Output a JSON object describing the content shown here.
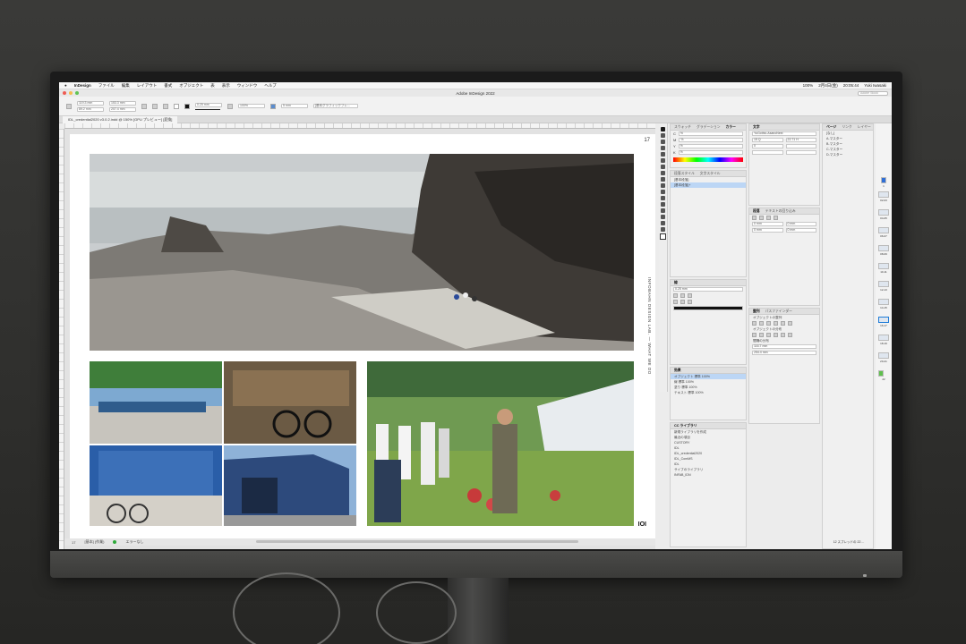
{
  "menubar": {
    "apple": "",
    "app_name": "InDesign",
    "menus": [
      "ファイル",
      "編集",
      "レイアウト",
      "書式",
      "オブジェクト",
      "表",
      "表示",
      "ウィンドウ",
      "ヘルプ"
    ],
    "right": [
      "100%",
      "2月4日(金)",
      "20:05:44",
      "Yuki Iwasaki"
    ]
  },
  "window": {
    "title": "Adobe InDesign 2022",
    "search_placeholder": "Adobe Stock"
  },
  "controlbar": {
    "x": "119.3 mm",
    "y": "89.2 mm",
    "w": "153.3 mm",
    "h": "207.4 mm",
    "stroke": "0.25 mm",
    "opacity": "100%",
    "offset": "5 mm",
    "style": "[基本グラフィックフレ..."
  },
  "doc_tab": "IDL_credential2020 v3.0.2.indd @ 150% [GPU プレビュー] [変換]",
  "page": {
    "number": "17",
    "side_text": "INFOBAHN DESIGN LAB. — WHAT WE DO",
    "logo": "IOI"
  },
  "statusbar": {
    "page": "17",
    "style": "[基本] (作業)",
    "errors": "エラーなし"
  },
  "colors": {
    "accent": "#1e7cd7",
    "selection": "#bcd6f5",
    "error_ok": "#2eaa3a"
  },
  "panels": {
    "swatch_tabs": [
      "スウォッチ",
      "グラデーション",
      "カラー"
    ],
    "swatch_channels": [
      "C",
      "M",
      "Y",
      "K"
    ],
    "swatch_values": [
      "%",
      "%",
      "%",
      "%"
    ],
    "char_style_tabs": [
      "段落スタイル",
      "文字スタイル"
    ],
    "char_style_items": [
      "[基本段落]",
      "[基本段落]+"
    ],
    "character_tabs": [
      "文字"
    ],
    "font": "YuGothic-AsanoNext",
    "font_size": "15 Q",
    "leading": "22.71 H",
    "tracking": "0",
    "paragraph_tabs": [
      "段落",
      "テキストの回り込み"
    ],
    "indent": "0 mm",
    "stroke_tabs": [
      "線"
    ],
    "stroke_width": "0.25 mm",
    "effect_tabs": [
      "効果"
    ],
    "effect_items": [
      {
        "label": "オブジェクト",
        "value": "標準 100%"
      },
      {
        "label": "線",
        "value": "標準 100%"
      },
      {
        "label": "塗り",
        "value": "標準 100%"
      },
      {
        "label": "テキスト",
        "value": "標準 100%"
      }
    ],
    "cc_tabs": [
      "CC ライブラリ"
    ],
    "cc_items": [
      "新規ライブラリを作成",
      "最近の項目",
      "CUSTORY",
      "IDL",
      "IDL_credential2020",
      "IDL_ComMS",
      "IDL",
      "サイブのライブラリ",
      "INFAB_IDN"
    ],
    "align_tabs": [
      "整列",
      "パスファインダー"
    ],
    "align_labels": [
      "オブジェクトの整列",
      "オブジェクトの分布",
      "間隔の分布"
    ],
    "transform_x": "116.7 mm",
    "transform_y": "254.4 mm",
    "pages_tabs": [
      "ページ",
      "リンク",
      "レイヤー"
    ],
    "masters": [
      "[なし]",
      "A-マスター",
      "B-マスター",
      "C-マスター",
      "D-マスター"
    ],
    "page_labels": [
      "1",
      "02-03",
      "04-05",
      "06-07",
      "08-09",
      "10-11",
      "12-13",
      "14-15",
      "16-17",
      "18-19",
      "20-21",
      "22"
    ],
    "pages_footer": "12 スプレッドの 22 ..."
  }
}
